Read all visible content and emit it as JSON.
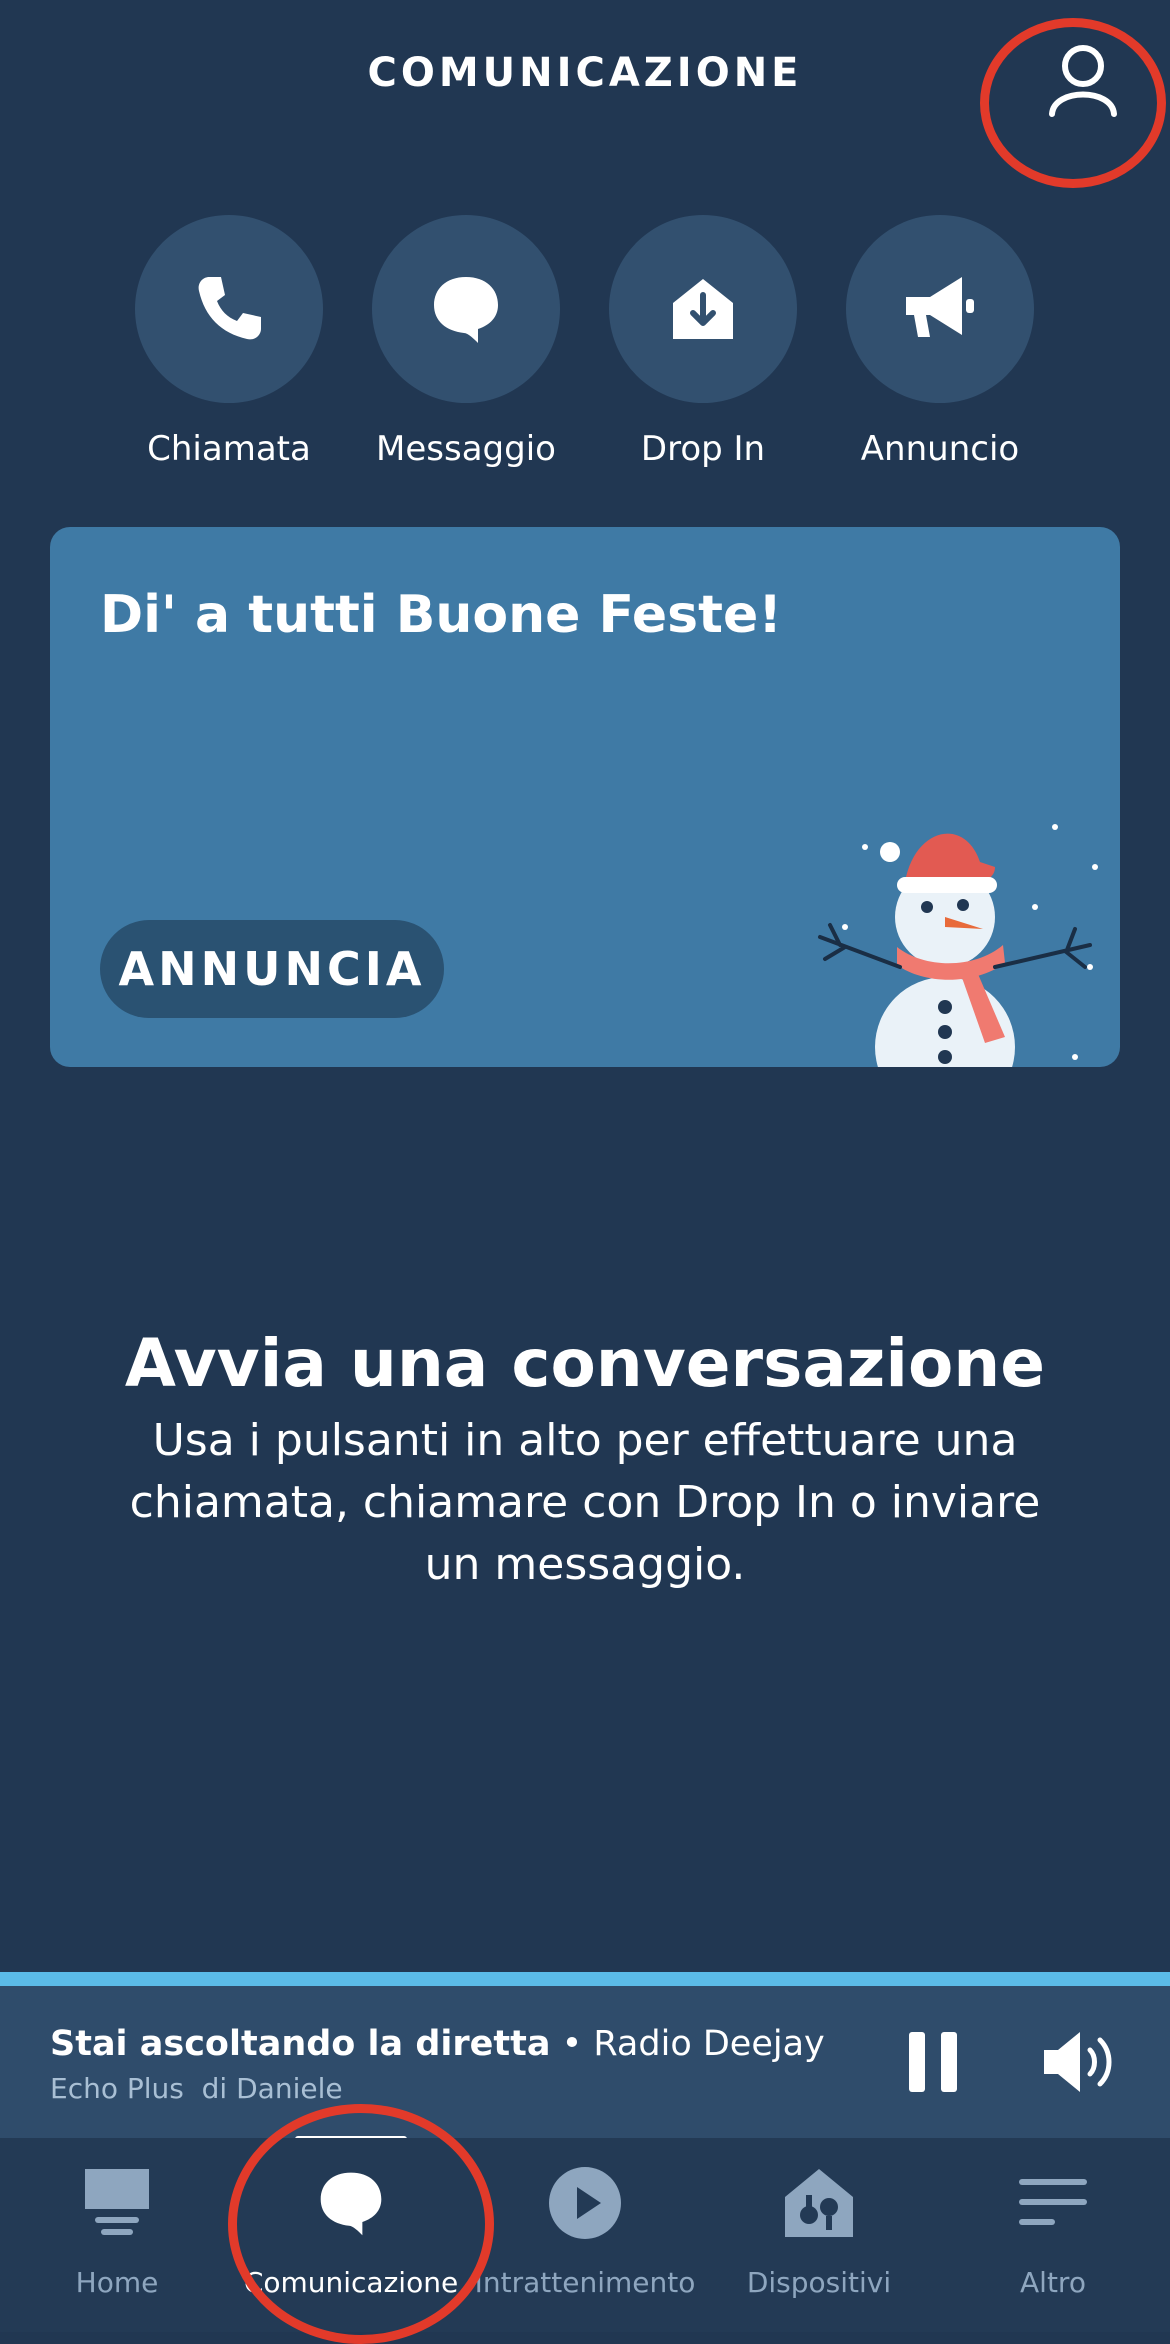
{
  "header": {
    "title": "COMUNICAZIONE",
    "profile_icon": "person-icon"
  },
  "actions": [
    {
      "label": "Chiamata",
      "icon": "phone-icon"
    },
    {
      "label": "Messaggio",
      "icon": "speech-bubble-icon"
    },
    {
      "label": "Drop In",
      "icon": "drop-in-icon"
    },
    {
      "label": "Annuncio",
      "icon": "megaphone-icon"
    }
  ],
  "card": {
    "title": "Di' a tutti Buone Feste!",
    "button_label": "ANNUNCIA",
    "illustration": "snowman"
  },
  "empty_state": {
    "title": "Avvia una conversazione",
    "description": "Usa i pulsanti in alto per effettuare una chiamata, chiamare con Drop In o inviare un messaggio."
  },
  "player": {
    "status": "Stai ascoltando la diretta",
    "separator": " • ",
    "station": "Radio Deejay",
    "device": "Echo Plus  di Daniele",
    "progress": 1.0
  },
  "tabs": [
    {
      "label": "Home",
      "icon": "home-icon",
      "active": false
    },
    {
      "label": "Comunicazione",
      "icon": "speech-bubble-icon",
      "active": true
    },
    {
      "label": "Intrattenimento",
      "icon": "play-icon",
      "active": false
    },
    {
      "label": "Dispositivi",
      "icon": "devices-icon",
      "active": false
    },
    {
      "label": "Altro",
      "icon": "menu-icon",
      "active": false
    }
  ],
  "colors": {
    "background": "#213752",
    "circle": "#32506f",
    "card": "#3f7aa5",
    "progress": "#5bbbe8",
    "annotation": "#e23a2a"
  }
}
